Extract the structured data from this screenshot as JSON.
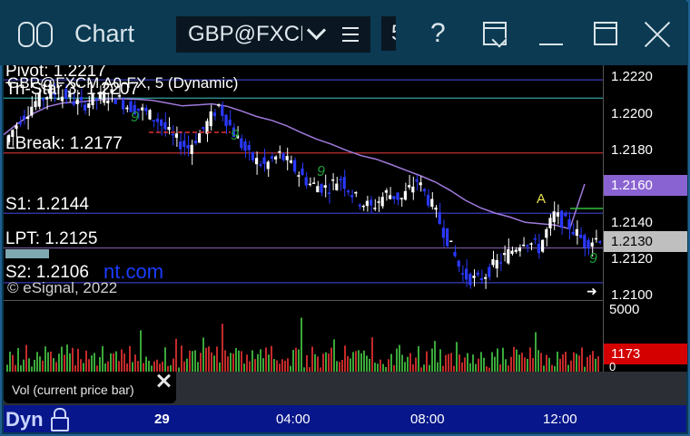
{
  "window": {
    "title": "Chart",
    "symbol": "GBP@FXCM",
    "interval_stub": "5"
  },
  "chart": {
    "header": "GBP@FXCM A0-FX, 5 (Dynamic)",
    "copyright": "© eSignal, 2022",
    "watermark": "nt.com",
    "levels": {
      "pivot": "Pivot: 1.2217",
      "tri_star": "Tri-Star 3: 1.2207",
      "lbreak": "LBreak: 1.2177",
      "s1": "S1: 1.2144",
      "lpt": "LPT: 1.2125",
      "s2": "S2: 1.2106"
    },
    "marker_a": "A",
    "seq_nine": "9"
  },
  "price_axis": {
    "ticks": [
      "1.2220",
      "1.2200",
      "1.2180",
      "1.2160",
      "1.2140",
      "1.2130",
      "1.2120",
      "1.2100"
    ],
    "highlight_ma": "1.2160",
    "highlight_last": "1.2130",
    "ma_color": "#8a63d2",
    "last_color": "#bfbfbf"
  },
  "volume_axis": {
    "top": "5000",
    "current": "1173",
    "bottom": "0",
    "current_color": "#d40000"
  },
  "legend": {
    "label": "Vol (current price bar)"
  },
  "time_axis": {
    "mode": "Dyn",
    "labels": [
      "29",
      "04:00",
      "08:00",
      "12:00"
    ]
  },
  "chart_data": {
    "type": "candlestick",
    "title": "GBP@FXCM A0-FX, 5 (Dynamic)",
    "ylim": [
      1.2097,
      1.2225
    ],
    "y_ticks": [
      1.222,
      1.22,
      1.218,
      1.216,
      1.214,
      1.212,
      1.21
    ],
    "x_ticks": [
      "29",
      "04:00",
      "08:00",
      "12:00"
    ],
    "horizontal_levels": [
      {
        "name": "Pivot",
        "value": 1.2217
      },
      {
        "name": "Tri-Star 3",
        "value": 1.2207
      },
      {
        "name": "LBreak",
        "value": 1.2177
      },
      {
        "name": "S1",
        "value": 1.2144
      },
      {
        "name": "LPT",
        "value": 1.2125
      },
      {
        "name": "S2",
        "value": 1.2106
      }
    ],
    "close_path": [
      1.2183,
      1.2196,
      1.2205,
      1.221,
      1.2208,
      1.2203,
      1.2207,
      1.2209,
      1.2203,
      1.22,
      1.2195,
      1.2185,
      1.218,
      1.219,
      1.2203,
      1.2188,
      1.2175,
      1.217,
      1.2176,
      1.2168,
      1.216,
      1.2158,
      1.2163,
      1.2152,
      1.2147,
      1.2155,
      1.2152,
      1.2162,
      1.2148,
      1.213,
      1.211,
      1.2107,
      1.2115,
      1.2122,
      1.213,
      1.2125,
      1.2143,
      1.2137,
      1.2128,
      1.2131
    ],
    "moving_average": {
      "last": 1.216
    },
    "volume": {
      "max": 5000,
      "current": 1173
    }
  }
}
